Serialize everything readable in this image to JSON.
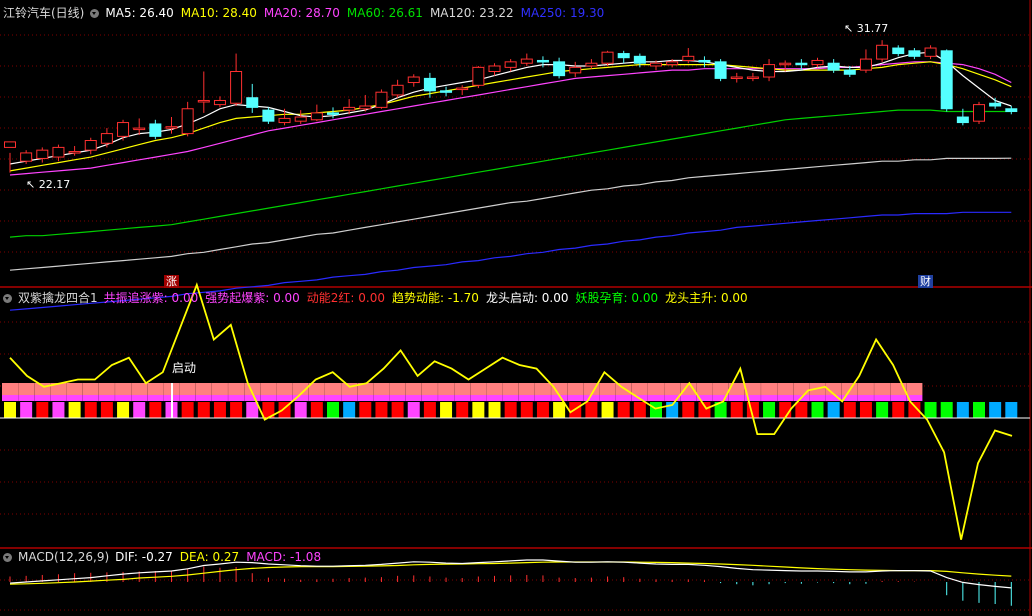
{
  "panel1": {
    "title": "江铃汽车(日线)",
    "mas": [
      {
        "label": "MA5: 26.40",
        "color": "#ffffff"
      },
      {
        "label": "MA10: 28.40",
        "color": "#ffff00"
      },
      {
        "label": "MA20: 28.70",
        "color": "#ff44ff"
      },
      {
        "label": "MA60: 26.61",
        "color": "#00e000"
      },
      {
        "label": "MA120: 23.22",
        "color": "#d8d8d8"
      },
      {
        "label": "MA250: 19.30",
        "color": "#3030ff"
      }
    ],
    "high_label": "31.77",
    "low_label": "22.17",
    "badge_up": "涨",
    "badge_fin": "财"
  },
  "panel2": {
    "title": "双紫擒龙四合1",
    "items": [
      {
        "label": "共振追涨紫: 0.00",
        "color": "#ff44ff"
      },
      {
        "label": "强势起爆紫: 0.00",
        "color": "#ff44ff"
      },
      {
        "label": "动能2红: 0.00",
        "color": "#ff3030"
      },
      {
        "label": "趋势动能: -1.70",
        "color": "#ffff00"
      },
      {
        "label": "龙头启动: 0.00",
        "color": "#ffffff"
      },
      {
        "label": "妖股孕育: 0.00",
        "color": "#00ff00"
      },
      {
        "label": "龙头主升: 0.00",
        "color": "#ffff00"
      }
    ],
    "start_label": "启动"
  },
  "panel3": {
    "title": "MACD(12,26,9)",
    "items": [
      {
        "label": "DIF: -0.27",
        "color": "#ffffff"
      },
      {
        "label": "DEA: 0.27",
        "color": "#ffff00"
      },
      {
        "label": "MACD: -1.08",
        "color": "#ff44ff"
      }
    ]
  },
  "chart_data": {
    "type": "candlestick",
    "candles": [
      [
        24.0,
        24.4,
        23.6,
        22.17
      ],
      [
        23.0,
        23.6,
        23.8,
        22.8
      ],
      [
        23.2,
        23.8,
        24.0,
        22.9
      ],
      [
        23.3,
        24.0,
        24.2,
        23.0
      ],
      [
        23.6,
        23.7,
        24.1,
        23.4
      ],
      [
        23.8,
        24.5,
        24.7,
        23.5
      ],
      [
        24.3,
        25.0,
        25.4,
        24.0
      ],
      [
        24.8,
        25.8,
        26.0,
        24.5
      ],
      [
        25.3,
        25.4,
        26.1,
        24.9
      ],
      [
        25.7,
        24.8,
        26.0,
        24.6
      ],
      [
        25.5,
        25.5,
        26.2,
        25.0
      ],
      [
        25.0,
        26.8,
        27.3,
        24.8
      ],
      [
        27.4,
        27.4,
        29.5,
        26.5
      ],
      [
        27.1,
        27.4,
        27.7,
        26.9
      ],
      [
        27.2,
        29.5,
        30.8,
        27.0
      ],
      [
        27.6,
        26.9,
        28.6,
        26.5
      ],
      [
        26.7,
        25.9,
        26.9,
        25.7
      ],
      [
        25.8,
        26.1,
        26.8,
        25.6
      ],
      [
        25.9,
        26.2,
        26.7,
        25.7
      ],
      [
        26.0,
        26.5,
        27.1,
        25.9
      ],
      [
        26.5,
        26.4,
        26.9,
        26.1
      ],
      [
        26.7,
        26.9,
        27.5,
        26.4
      ],
      [
        26.8,
        27.0,
        27.8,
        26.6
      ],
      [
        26.9,
        28.0,
        28.2,
        26.8
      ],
      [
        27.8,
        28.5,
        28.9,
        27.6
      ],
      [
        28.7,
        29.1,
        29.3,
        28.4
      ],
      [
        29.0,
        28.1,
        29.4,
        27.6
      ],
      [
        28.1,
        28.0,
        28.4,
        27.7
      ],
      [
        28.3,
        28.3,
        28.5,
        27.8
      ],
      [
        28.5,
        29.8,
        29.9,
        28.3
      ],
      [
        29.5,
        29.9,
        30.1,
        29.2
      ],
      [
        29.8,
        30.2,
        30.4,
        29.5
      ],
      [
        30.1,
        30.4,
        30.8,
        29.9
      ],
      [
        30.3,
        30.2,
        30.6,
        29.8
      ],
      [
        30.2,
        29.2,
        30.5,
        29.0
      ],
      [
        29.4,
        29.8,
        30.2,
        29.1
      ],
      [
        29.9,
        30.1,
        30.4,
        29.7
      ],
      [
        30.1,
        30.9,
        31.0,
        29.9
      ],
      [
        30.8,
        30.5,
        31.0,
        30.1
      ],
      [
        30.6,
        30.1,
        30.8,
        29.8
      ],
      [
        29.9,
        30.1,
        30.3,
        29.6
      ],
      [
        30.0,
        30.2,
        30.4,
        29.8
      ],
      [
        30.3,
        30.6,
        31.2,
        30.1
      ],
      [
        30.3,
        30.2,
        30.6,
        29.8
      ],
      [
        30.2,
        29.0,
        30.4,
        28.8
      ],
      [
        29.0,
        29.1,
        29.4,
        28.7
      ],
      [
        29.1,
        29.1,
        29.4,
        28.8
      ],
      [
        29.1,
        30.0,
        30.4,
        28.8
      ],
      [
        30.0,
        30.1,
        30.3,
        29.5
      ],
      [
        30.1,
        30.0,
        30.4,
        29.6
      ],
      [
        30.0,
        30.3,
        30.5,
        29.8
      ],
      [
        30.1,
        29.6,
        30.4,
        29.4
      ],
      [
        29.6,
        29.3,
        29.9,
        29.1
      ],
      [
        29.6,
        30.4,
        31.1,
        29.4
      ],
      [
        30.4,
        31.4,
        31.77,
        30.2
      ],
      [
        31.2,
        30.8,
        31.4,
        30.6
      ],
      [
        31.0,
        30.6,
        31.2,
        30.4
      ],
      [
        30.6,
        31.2,
        31.4,
        30.4
      ],
      [
        31.0,
        26.8,
        31.1,
        26.6
      ],
      [
        26.2,
        25.8,
        26.8,
        25.6
      ],
      [
        25.9,
        27.1,
        27.3,
        25.7
      ],
      [
        27.2,
        27.0,
        27.6,
        26.8
      ],
      [
        26.8,
        26.6,
        27.0,
        26.4
      ]
    ],
    "ma5": [
      22.8,
      23.0,
      23.2,
      23.4,
      23.6,
      23.8,
      24.2,
      24.7,
      25.0,
      25.1,
      25.3,
      25.7,
      26.2,
      26.8,
      27.1,
      27.0,
      26.9,
      26.6,
      26.3,
      26.2,
      26.3,
      26.5,
      26.7,
      27.1,
      27.6,
      28.0,
      28.3,
      28.5,
      28.7,
      28.9,
      29.2,
      29.5,
      29.8,
      30.0,
      30.0,
      29.9,
      29.9,
      30.0,
      30.1,
      30.2,
      30.2,
      30.3,
      30.3,
      30.2,
      30.0,
      29.8,
      29.6,
      29.5,
      29.5,
      29.6,
      29.8,
      29.9,
      29.8,
      29.8,
      30.1,
      30.5,
      30.8,
      30.9,
      30.2,
      29.2,
      28.3,
      27.4,
      27.0
    ],
    "ma10": [
      22.3,
      22.5,
      22.7,
      22.9,
      23.1,
      23.3,
      23.6,
      23.9,
      24.2,
      24.5,
      24.7,
      25.0,
      25.4,
      25.8,
      26.1,
      26.2,
      26.3,
      26.4,
      26.4,
      26.5,
      26.6,
      26.7,
      26.9,
      27.1,
      27.4,
      27.7,
      27.9,
      28.1,
      28.3,
      28.5,
      28.7,
      28.9,
      29.1,
      29.3,
      29.5,
      29.6,
      29.7,
      29.8,
      29.9,
      30.0,
      30.0,
      30.0,
      30.0,
      30.0,
      30.0,
      29.9,
      29.8,
      29.7,
      29.6,
      29.6,
      29.6,
      29.6,
      29.6,
      29.7,
      29.8,
      30.0,
      30.1,
      30.2,
      30.0,
      29.7,
      29.3,
      28.9,
      28.4
    ],
    "ma20": [
      22.0,
      22.1,
      22.2,
      22.3,
      22.4,
      22.5,
      22.7,
      22.9,
      23.1,
      23.3,
      23.5,
      23.7,
      24.0,
      24.3,
      24.6,
      24.9,
      25.2,
      25.4,
      25.6,
      25.8,
      26.0,
      26.2,
      26.4,
      26.6,
      26.8,
      27.0,
      27.2,
      27.4,
      27.6,
      27.8,
      28.0,
      28.2,
      28.4,
      28.6,
      28.8,
      29.0,
      29.1,
      29.2,
      29.3,
      29.4,
      29.5,
      29.6,
      29.6,
      29.7,
      29.7,
      29.7,
      29.7,
      29.7,
      29.7,
      29.7,
      29.7,
      29.8,
      29.8,
      29.9,
      30.0,
      30.1,
      30.2,
      30.2,
      30.1,
      30.0,
      29.7,
      29.3,
      28.7
    ],
    "ma60": [
      17.5,
      17.6,
      17.6,
      17.7,
      17.8,
      17.9,
      18.0,
      18.1,
      18.2,
      18.3,
      18.4,
      18.6,
      18.8,
      19.0,
      19.2,
      19.4,
      19.6,
      19.8,
      20.0,
      20.2,
      20.4,
      20.6,
      20.8,
      21.0,
      21.2,
      21.4,
      21.6,
      21.8,
      22.0,
      22.2,
      22.4,
      22.6,
      22.8,
      23.0,
      23.2,
      23.4,
      23.6,
      23.8,
      24.0,
      24.2,
      24.4,
      24.6,
      24.8,
      25.0,
      25.2,
      25.4,
      25.6,
      25.8,
      26.0,
      26.1,
      26.2,
      26.3,
      26.4,
      26.5,
      26.6,
      26.7,
      26.7,
      26.7,
      26.6,
      26.6,
      26.6,
      26.6,
      26.6
    ],
    "ma120": [
      15.1,
      15.2,
      15.3,
      15.4,
      15.5,
      15.6,
      15.7,
      15.8,
      15.9,
      16.0,
      16.1,
      16.3,
      16.4,
      16.6,
      16.8,
      17.0,
      17.1,
      17.3,
      17.5,
      17.7,
      17.8,
      18.0,
      18.2,
      18.4,
      18.6,
      18.8,
      19.0,
      19.2,
      19.4,
      19.6,
      19.8,
      20.0,
      20.1,
      20.3,
      20.5,
      20.7,
      20.9,
      21.0,
      21.2,
      21.3,
      21.5,
      21.6,
      21.8,
      21.9,
      22.0,
      22.1,
      22.2,
      22.3,
      22.4,
      22.5,
      22.6,
      22.7,
      22.8,
      22.9,
      23.0,
      23.0,
      23.1,
      23.1,
      23.2,
      23.2,
      23.2,
      23.2,
      23.22
    ],
    "ma250": [
      12.2,
      12.3,
      12.4,
      12.5,
      12.6,
      12.7,
      12.8,
      12.9,
      13.0,
      13.1,
      13.2,
      13.4,
      13.5,
      13.6,
      13.8,
      13.9,
      14.0,
      14.2,
      14.3,
      14.4,
      14.6,
      14.7,
      14.8,
      15.0,
      15.1,
      15.3,
      15.4,
      15.5,
      15.7,
      15.8,
      16.0,
      16.1,
      16.3,
      16.4,
      16.6,
      16.7,
      16.9,
      17.0,
      17.2,
      17.3,
      17.5,
      17.6,
      17.8,
      17.9,
      18.0,
      18.2,
      18.3,
      18.4,
      18.5,
      18.6,
      18.7,
      18.8,
      18.9,
      19.0,
      19.1,
      19.1,
      19.2,
      19.2,
      19.2,
      19.3,
      19.3,
      19.3,
      19.3
    ],
    "trend_momentum": [
      2.6,
      1.6,
      1.0,
      1.2,
      1.4,
      1.4,
      2.2,
      2.6,
      1.2,
      1.8,
      4.2,
      6.6,
      3.6,
      4.4,
      1.2,
      -0.8,
      -0.3,
      0.5,
      1.4,
      1.8,
      1.0,
      1.2,
      2.0,
      3.0,
      1.6,
      2.4,
      2.0,
      1.4,
      2.0,
      2.6,
      2.2,
      2.0,
      1.0,
      -0.4,
      0.2,
      1.8,
      1.0,
      0.4,
      -0.2,
      0.0,
      1.2,
      -0.2,
      0.2,
      2.0,
      -1.6,
      -1.6,
      -0.2,
      0.8,
      1.0,
      0.2,
      1.6,
      3.6,
      2.2,
      0.2,
      -0.8,
      -2.6,
      -7.4,
      -3.2,
      -1.4,
      -1.7
    ],
    "signal_bars": [
      "Y",
      "M",
      "R",
      "M",
      "Y",
      "R",
      "R",
      "Y",
      "M",
      "R",
      "M",
      "R",
      "R",
      "R",
      "R",
      "M",
      "R",
      "R",
      "M",
      "R",
      "G",
      "C",
      "R",
      "R",
      "R",
      "M",
      "R",
      "Y",
      "R",
      "Y",
      "Y",
      "R",
      "R",
      "R",
      "Y",
      "R",
      "R",
      "Y",
      "R",
      "R",
      "G",
      "C",
      "R",
      "R",
      "G",
      "R",
      "R",
      "G",
      "R",
      "R",
      "G",
      "C",
      "R",
      "R",
      "G",
      "R",
      "R",
      "G",
      "G",
      "C",
      "G",
      "C",
      "C"
    ],
    "macd_hist": [
      0.25,
      0.28,
      0.32,
      0.35,
      0.4,
      0.42,
      0.44,
      0.46,
      0.48,
      0.5,
      0.52,
      0.6,
      0.7,
      0.65,
      0.68,
      0.4,
      0.2,
      0.15,
      0.1,
      0.12,
      0.15,
      0.18,
      0.2,
      0.22,
      0.28,
      0.3,
      0.25,
      0.2,
      0.18,
      0.25,
      0.28,
      0.3,
      0.32,
      0.3,
      0.2,
      0.18,
      0.2,
      0.25,
      0.22,
      0.15,
      0.12,
      0.1,
      0.12,
      0.08,
      -0.05,
      -0.1,
      -0.15,
      -0.1,
      -0.05,
      -0.08,
      -0.02,
      -0.05,
      -0.1,
      -0.08,
      0.05,
      0.04,
      0.02,
      0.0,
      -0.6,
      -0.85,
      -0.95,
      -1.0,
      -1.08
    ],
    "dif": [
      -0.05,
      0.0,
      0.05,
      0.1,
      0.15,
      0.2,
      0.28,
      0.36,
      0.42,
      0.46,
      0.5,
      0.6,
      0.75,
      0.82,
      0.9,
      0.88,
      0.82,
      0.78,
      0.74,
      0.72,
      0.72,
      0.74,
      0.76,
      0.8,
      0.86,
      0.92,
      0.9,
      0.86,
      0.84,
      0.88,
      0.92,
      0.96,
      1.0,
      1.0,
      0.95,
      0.9,
      0.9,
      0.92,
      0.9,
      0.86,
      0.82,
      0.8,
      0.8,
      0.76,
      0.7,
      0.62,
      0.56,
      0.54,
      0.52,
      0.5,
      0.5,
      0.48,
      0.46,
      0.46,
      0.5,
      0.52,
      0.52,
      0.5,
      0.2,
      -0.02,
      -0.12,
      -0.2,
      -0.27
    ],
    "dea": [
      -0.1,
      -0.08,
      -0.06,
      -0.03,
      0.0,
      0.04,
      0.08,
      0.12,
      0.18,
      0.22,
      0.26,
      0.32,
      0.4,
      0.48,
      0.56,
      0.62,
      0.66,
      0.68,
      0.7,
      0.7,
      0.7,
      0.71,
      0.72,
      0.73,
      0.75,
      0.78,
      0.8,
      0.81,
      0.82,
      0.83,
      0.84,
      0.86,
      0.88,
      0.9,
      0.91,
      0.91,
      0.91,
      0.91,
      0.91,
      0.9,
      0.89,
      0.88,
      0.86,
      0.84,
      0.82,
      0.79,
      0.76,
      0.72,
      0.68,
      0.64,
      0.61,
      0.58,
      0.56,
      0.54,
      0.53,
      0.52,
      0.52,
      0.52,
      0.48,
      0.42,
      0.36,
      0.31,
      0.27
    ]
  }
}
